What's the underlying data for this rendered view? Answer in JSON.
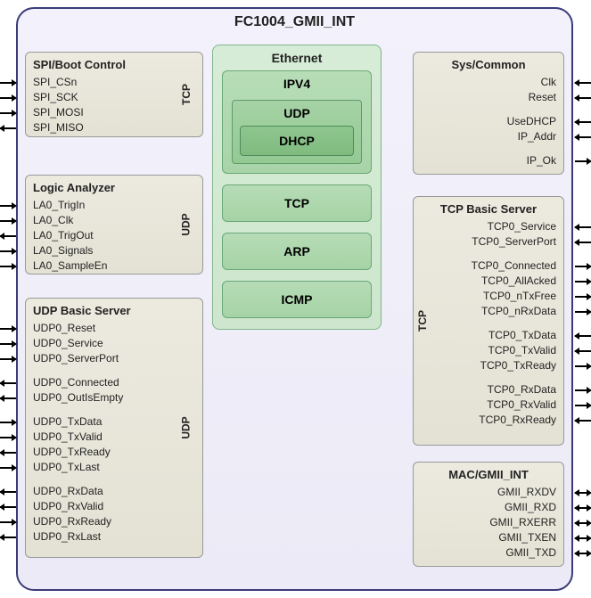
{
  "title": "FC1004_GMII_INT",
  "left_blocks": [
    {
      "id": "spi",
      "title": "SPI/Boot Control",
      "protocol": "TCP",
      "groups": [
        [
          "SPI_CSn",
          "SPI_SCK",
          "SPI_MOSI",
          "SPI_MISO"
        ]
      ],
      "dirs": [
        [
          "in",
          "in",
          "in",
          "out"
        ]
      ]
    },
    {
      "id": "la",
      "title": "Logic Analyzer",
      "protocol": "UDP",
      "groups": [
        [
          "LA0_TrigIn",
          "LA0_Clk",
          "LA0_TrigOut",
          "LA0_Signals",
          "LA0_SampleEn"
        ]
      ],
      "dirs": [
        [
          "in",
          "in",
          "out",
          "in",
          "in"
        ]
      ]
    },
    {
      "id": "udpbs",
      "title": "UDP Basic Server",
      "protocol": "UDP",
      "groups": [
        [
          "UDP0_Reset",
          "UDP0_Service",
          "UDP0_ServerPort"
        ],
        [
          "UDP0_Connected",
          "UDP0_OutIsEmpty"
        ],
        [
          "UDP0_TxData",
          "UDP0_TxValid",
          "UDP0_TxReady",
          "UDP0_TxLast"
        ],
        [
          "UDP0_RxData",
          "UDP0_RxValid",
          "UDP0_RxReady",
          "UDP0_RxLast"
        ]
      ],
      "dirs": [
        [
          "in",
          "in",
          "in"
        ],
        [
          "out",
          "out"
        ],
        [
          "in",
          "in",
          "out",
          "in"
        ],
        [
          "out",
          "out",
          "in",
          "out"
        ]
      ]
    }
  ],
  "right_blocks": [
    {
      "id": "sys",
      "title": "Sys/Common",
      "protocol": "",
      "groups": [
        [
          "Clk",
          "Reset"
        ],
        [
          "UseDHCP",
          "IP_Addr"
        ],
        [
          "IP_Ok"
        ]
      ],
      "dirs": [
        [
          "in",
          "in"
        ],
        [
          "in",
          "in"
        ],
        [
          "out"
        ]
      ]
    },
    {
      "id": "tcpbs",
      "title": "TCP Basic Server",
      "protocol": "TCP",
      "groups": [
        [
          "TCP0_Service",
          "TCP0_ServerPort"
        ],
        [
          "TCP0_Connected",
          "TCP0_AllAcked",
          "TCP0_nTxFree",
          "TCP0_nRxData"
        ],
        [
          "TCP0_TxData",
          "TCP0_TxValid",
          "TCP0_TxReady"
        ],
        [
          "TCP0_RxData",
          "TCP0_RxValid",
          "TCP0_RxReady"
        ]
      ],
      "dirs": [
        [
          "in",
          "in"
        ],
        [
          "out",
          "out",
          "out",
          "out"
        ],
        [
          "in",
          "in",
          "out"
        ],
        [
          "out",
          "out",
          "in"
        ]
      ]
    },
    {
      "id": "mac",
      "title": "MAC/GMII_INT",
      "protocol": "",
      "groups": [
        [
          "GMII_RXDV",
          "GMII_RXD",
          "GMII_RXERR",
          "GMII_TXEN",
          "GMII_TXD"
        ]
      ],
      "dirs": [
        [
          "bi",
          "bi",
          "bi",
          "bi",
          "bi"
        ]
      ]
    }
  ],
  "ethernet": {
    "title": "Ethernet",
    "ipv4_title": "IPV4",
    "udp_title": "UDP",
    "dhcp_title": "DHCP",
    "protocols": [
      "TCP",
      "ARP",
      "ICMP"
    ]
  }
}
